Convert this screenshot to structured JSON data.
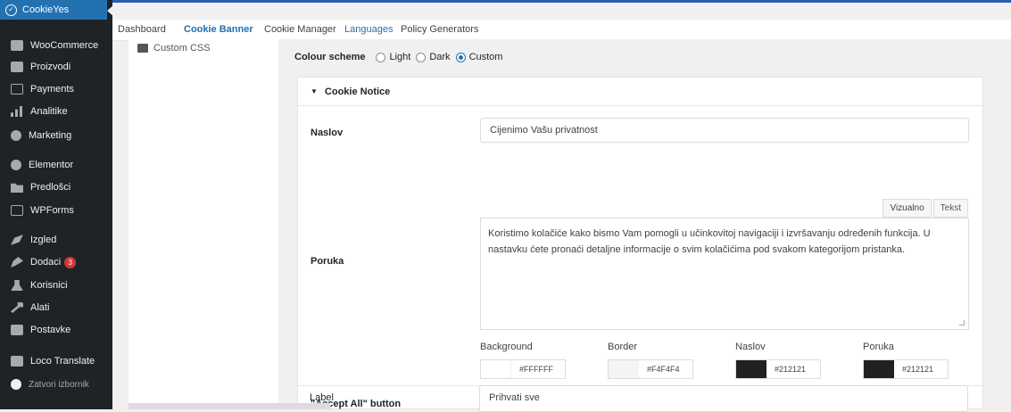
{
  "sidebar": {
    "brand": "CookieYes",
    "items": [
      {
        "label": "WooCommerce",
        "icon": "woocommerce-icon"
      },
      {
        "label": "Proizvodi",
        "icon": "products-icon"
      },
      {
        "label": "Payments",
        "icon": "payments-icon"
      },
      {
        "label": "Analitike",
        "icon": "analytics-icon"
      },
      {
        "label": "Marketing",
        "icon": "marketing-icon"
      },
      {
        "label": "Elementor",
        "icon": "elementor-icon"
      },
      {
        "label": "Predlošci",
        "icon": "templates-icon"
      },
      {
        "label": "WPForms",
        "icon": "wpforms-icon"
      },
      {
        "label": "Izgled",
        "icon": "appearance-icon"
      },
      {
        "label": "Dodaci",
        "icon": "plugins-icon",
        "badge": "3"
      },
      {
        "label": "Korisnici",
        "icon": "users-icon"
      },
      {
        "label": "Alati",
        "icon": "tools-icon"
      },
      {
        "label": "Postavke",
        "icon": "settings-icon"
      },
      {
        "label": "Loco Translate",
        "icon": "translate-icon"
      },
      {
        "label": "Zatvori izbornik",
        "icon": "collapse-icon"
      }
    ]
  },
  "tabs": [
    {
      "label": "Dashboard"
    },
    {
      "label": "Cookie Banner"
    },
    {
      "label": "Cookie Manager"
    },
    {
      "label": "Languages"
    },
    {
      "label": "Policy Generators"
    }
  ],
  "leftpanel": {
    "custom_css": "Custom CSS"
  },
  "colour_scheme": {
    "label": "Colour scheme",
    "options": [
      "Light",
      "Dark",
      "Custom"
    ],
    "selected": "Custom"
  },
  "section": {
    "title": "Cookie Notice",
    "naslov_label": "Naslov",
    "naslov_value": "Cijenimo Vašu privatnost",
    "poruka_label": "Poruka",
    "editor_tabs": [
      "Vizualno",
      "Tekst"
    ],
    "poruka_value": "Koristimo kolačiće kako bismo Vam pomogli u učinkovitoj navigaciji i izvršavanju određenih funkcija. U nastavku ćete pronaći detaljne informacije o svim kolačićima pod svakom kategorijom pristanka.",
    "colors": [
      {
        "label": "Background",
        "value": "#FFFFFF",
        "swatch": "#FFFFFF"
      },
      {
        "label": "Border",
        "value": "#F4F4F4",
        "swatch": "#F4F4F4"
      },
      {
        "label": "Naslov",
        "value": "#212121",
        "swatch": "#212121"
      },
      {
        "label": "Poruka",
        "value": "#212121",
        "swatch": "#212121"
      }
    ],
    "accept_all_title": "\"Accept All\" button",
    "label_label": "Label",
    "label_value": "Prihvati sve"
  }
}
